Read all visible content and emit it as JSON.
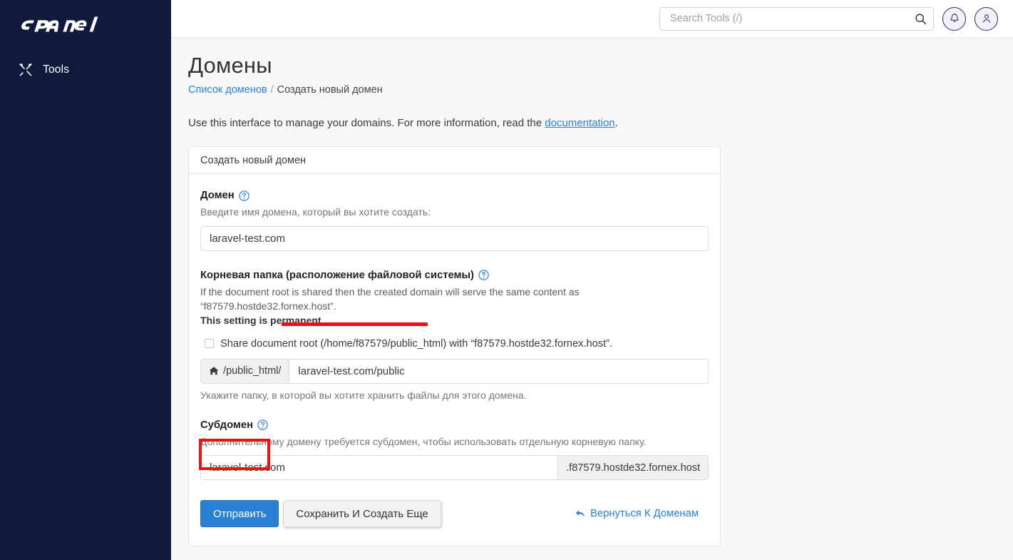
{
  "sidebar": {
    "logo_text": "cPanel",
    "items": [
      {
        "label": "Tools",
        "icon": "tools-icon"
      }
    ]
  },
  "header": {
    "search": {
      "placeholder": "Search Tools (/)",
      "value": "",
      "icon": "search-icon"
    },
    "notifications_icon": "bell-icon",
    "account_icon": "user-icon"
  },
  "page": {
    "title": "Домены",
    "breadcrumb": {
      "link": "Список доменов",
      "separator": "/",
      "current": "Создать новый домен"
    },
    "intro_before": "Use this interface to manage your domains. For more information, read the ",
    "intro_link": "documentation",
    "intro_after": "."
  },
  "panel": {
    "heading": "Создать новый домен",
    "domain": {
      "label": "Домен",
      "help_icon": "help-circle-icon",
      "hint": "Введите имя домена, который вы хотите создать:",
      "value": "laravel-test.com"
    },
    "document_root": {
      "label": "Корневая папка (расположение файловой системы)",
      "help_icon": "help-circle-icon",
      "hint": "If the document root is shared then the created domain will serve the same content as “f87579.hostde32.fornex.host”.",
      "hint_strong": "This setting is permanent.",
      "share_checkbox_label": "Share document root (/home/f87579/public_html) with “f87579.hostde32.fornex.host”.",
      "share_checked": false,
      "prefix_icon": "home-icon",
      "prefix": "/public_html/",
      "value": "laravel-test.com/public",
      "sub_hint": "Укажите папку, в которой вы хотите хранить файлы для этого домена."
    },
    "subdomain": {
      "label": "Субдомен",
      "help_icon": "help-circle-icon",
      "hint": "Дополнительному домену требуется субдомен, чтобы использовать отдельную корневую папку.",
      "value": "laravel-test.com",
      "suffix": ".f87579.hostde32.fornex.host"
    },
    "actions": {
      "submit_label": "Отправить",
      "save_and_create_label": "Сохранить И Создать Еще",
      "back_label": "Вернуться К Доменам",
      "back_icon": "back-arrow-icon"
    }
  },
  "annotations": {
    "highlight_color": "#ee1015",
    "underline_target": "document-root-input",
    "box_target": "submit-button"
  }
}
